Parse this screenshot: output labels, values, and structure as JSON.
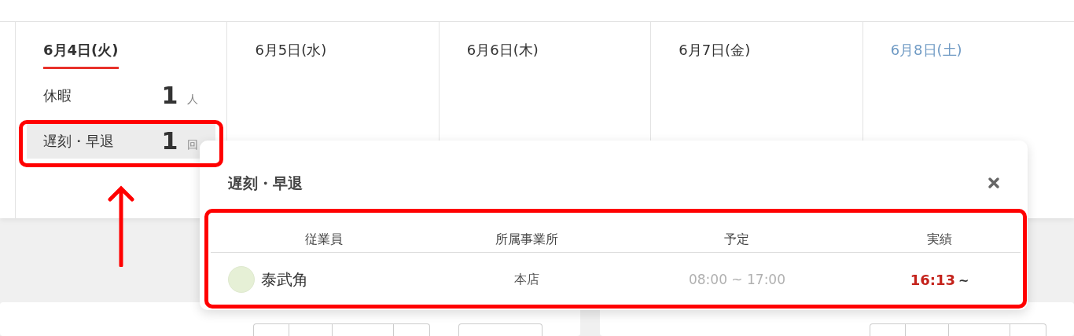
{
  "days": [
    {
      "label": "6月4日(火)",
      "selected": true,
      "kind": "weekday",
      "stats": [
        {
          "label": "休暇",
          "count": "1",
          "unit": "人",
          "highlighted": false
        },
        {
          "label": "遅刻・早退",
          "count": "1",
          "unit": "回",
          "highlighted": true
        }
      ]
    },
    {
      "label": "6月5日(水)",
      "selected": false,
      "kind": "weekday"
    },
    {
      "label": "6月6日(木)",
      "selected": false,
      "kind": "weekday"
    },
    {
      "label": "6月7日(金)",
      "selected": false,
      "kind": "weekday"
    },
    {
      "label": "6月8日(土)",
      "selected": false,
      "kind": "saturday"
    }
  ],
  "popover": {
    "title": "遅刻・早退",
    "columns": [
      "従業員",
      "所属事業所",
      "予定",
      "実績"
    ],
    "rows": [
      {
        "employee": "泰武角",
        "office": "本店",
        "scheduled": "08:00 ~ 17:00",
        "actual": "16:13",
        "actual_suffix": "~"
      }
    ]
  }
}
